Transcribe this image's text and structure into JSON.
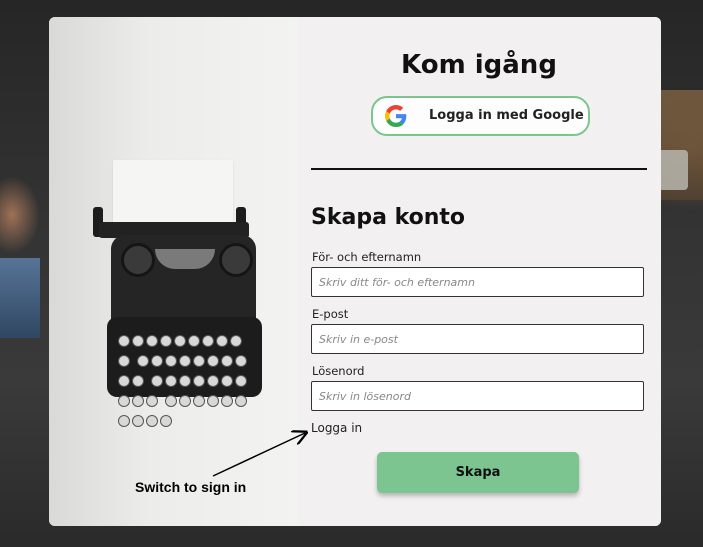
{
  "header": {
    "title": "Kom igång"
  },
  "google": {
    "label": "Logga in med Google",
    "icon": "google-g-icon"
  },
  "form": {
    "heading": "Skapa konto",
    "name_label": "För- och efternamn",
    "name_placeholder": "Skriv ditt för- och efternamn",
    "email_label": "E-post",
    "email_placeholder": "Skriv in e-post",
    "password_label": "Lösenord",
    "password_placeholder": "Skriv in lösenord",
    "login_link": "Logga in",
    "submit_label": "Skapa"
  },
  "annotation": {
    "text": "Switch to sign in"
  },
  "colors": {
    "accent": "#7cc590",
    "google_border": "#7cc68e",
    "panel": "#f2f0f0"
  }
}
